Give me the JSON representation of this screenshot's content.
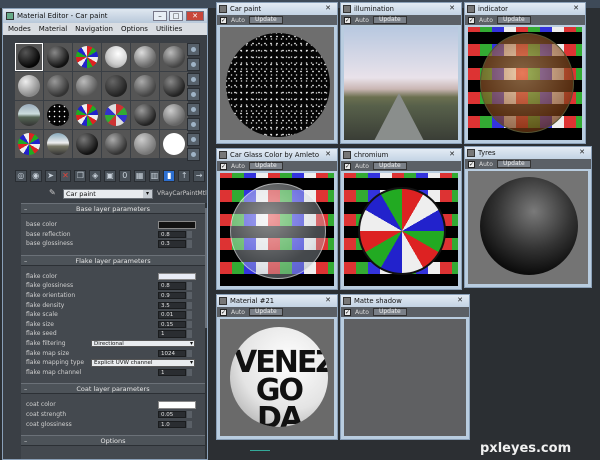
{
  "material_editor": {
    "title": "Material Editor - Car paint",
    "menu": [
      "Modes",
      "Material",
      "Navigation",
      "Options",
      "Utilities"
    ],
    "material_name": "Car paint",
    "material_type": "VRayCarPaintMtl",
    "rollouts": [
      {
        "title": "Base layer parameters",
        "params": [
          {
            "label": "base color",
            "kind": "swatch",
            "color": "#111111"
          },
          {
            "label": "base reflection",
            "kind": "spinner",
            "value": "0.8"
          },
          {
            "label": "base glossiness",
            "kind": "spinner",
            "value": "0.3"
          }
        ]
      },
      {
        "title": "Flake layer parameters",
        "params": [
          {
            "label": "flake color",
            "kind": "swatch",
            "color": "#e8ecf6"
          },
          {
            "label": "flake glossiness",
            "kind": "spinner",
            "value": "0.8"
          },
          {
            "label": "flake orientation",
            "kind": "spinner",
            "value": "0.9"
          },
          {
            "label": "flake density",
            "kind": "spinner",
            "value": "3.5"
          },
          {
            "label": "flake scale",
            "kind": "spinner",
            "value": "0.01"
          },
          {
            "label": "flake size",
            "kind": "spinner",
            "value": "0.15"
          },
          {
            "label": "flake seed",
            "kind": "spinner",
            "value": "1"
          },
          {
            "label": "flake filtering",
            "kind": "dropdown",
            "value": "Directional"
          },
          {
            "label": "flake map size",
            "kind": "spinner",
            "value": "1024"
          },
          {
            "label": "flake mapping type",
            "kind": "dropdown",
            "value": "Explicit UVW channel"
          },
          {
            "label": "flake map channel",
            "kind": "spinner",
            "value": "1"
          }
        ]
      },
      {
        "title": "Coat layer parameters",
        "params": [
          {
            "label": "coat color",
            "kind": "swatch",
            "color": "#ffffff"
          },
          {
            "label": "coat strength",
            "kind": "spinner",
            "value": "0.05"
          },
          {
            "label": "coat glossiness",
            "kind": "spinner",
            "value": "1.0"
          }
        ]
      },
      {
        "title": "Options",
        "params": []
      }
    ]
  },
  "previews": [
    {
      "title": "Car paint",
      "auto": "Auto",
      "update": "Update"
    },
    {
      "title": "illumination",
      "auto": "Auto",
      "update": "Update"
    },
    {
      "title": "indicator",
      "auto": "Auto",
      "update": "Update"
    },
    {
      "title": "Car Glass Color by Amleto",
      "auto": "Auto",
      "update": "Update"
    },
    {
      "title": "chromium",
      "auto": "Auto",
      "update": "Update"
    },
    {
      "title": "Tyres",
      "auto": "Auto",
      "update": "Update"
    },
    {
      "title": "Material #21",
      "auto": "Auto",
      "update": "Update"
    },
    {
      "title": "Matte shadow",
      "auto": "Auto",
      "update": "Update"
    }
  ],
  "ball_text": "VENEZUELA GO DA",
  "watermark": "pxleyes.com"
}
